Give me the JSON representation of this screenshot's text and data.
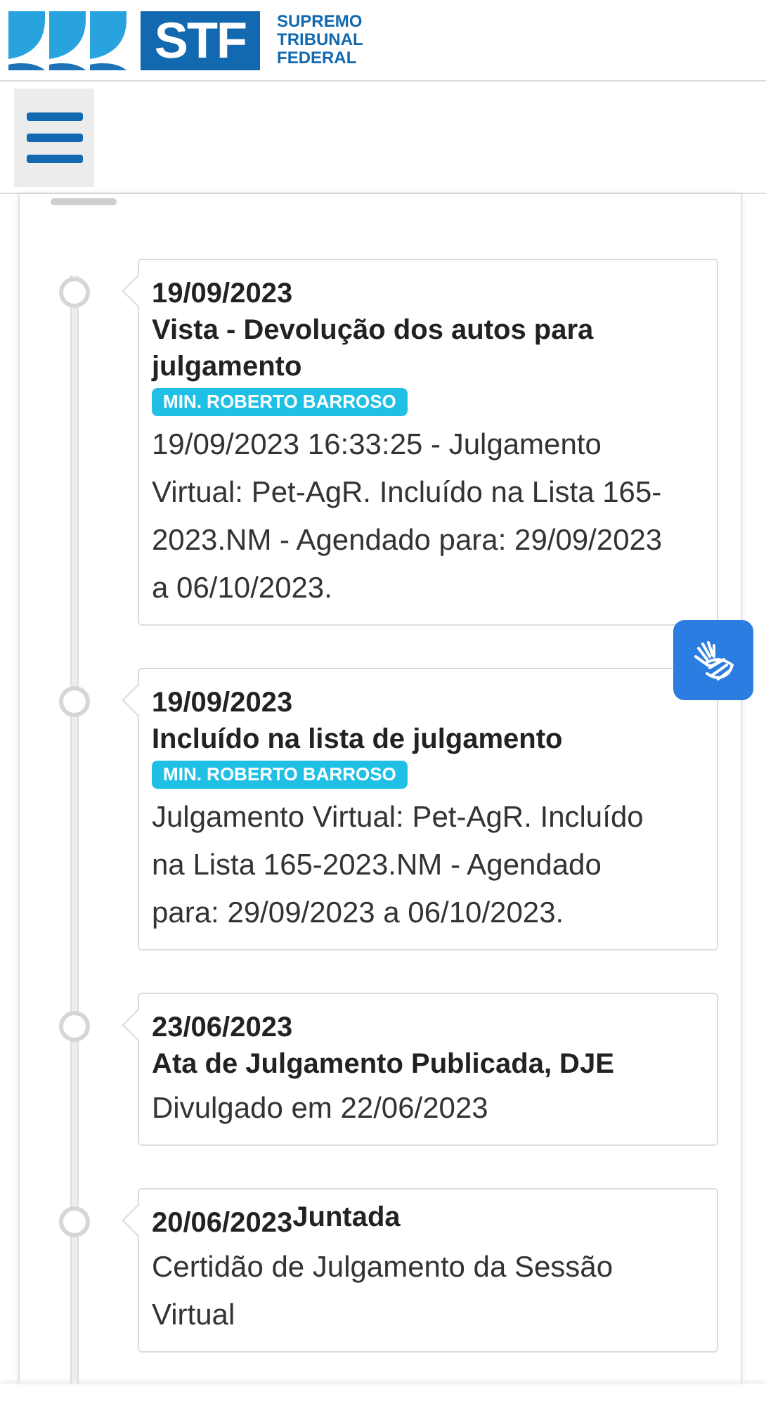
{
  "header": {
    "logo_text": "STF",
    "org_name": [
      "SUPREMO",
      "TRIBUNAL",
      "FEDERAL"
    ]
  },
  "timeline": [
    {
      "kind": "stacked",
      "date": "19/09/2023",
      "title": "Vista - Devolução dos autos para julgamento",
      "badge": "MIN. ROBERTO BARROSO",
      "body": "19/09/2023 16:33:25 - Julgamento Virtual: Pet-AgR. Incluído na Lista 165-2023.NM - Agendado para: 29/09/2023 a 06/10/2023."
    },
    {
      "kind": "stacked",
      "date": "19/09/2023",
      "title": "Incluído na lista de julgamento",
      "badge": "MIN. ROBERTO BARROSO",
      "body": "Julgamento Virtual: Pet-AgR. Incluído na Lista 165-2023.NM - Agendado para: 29/09/2023 a 06/10/2023."
    },
    {
      "kind": "stacked",
      "date": "23/06/2023",
      "title": "Ata de Julgamento Publicada, DJE",
      "body": "Divulgado em 22/06/2023"
    },
    {
      "kind": "inline",
      "date": "20/06/2023",
      "title": "Juntada",
      "body": "Certidão de Julgamento da Sessão Virtual"
    }
  ]
}
